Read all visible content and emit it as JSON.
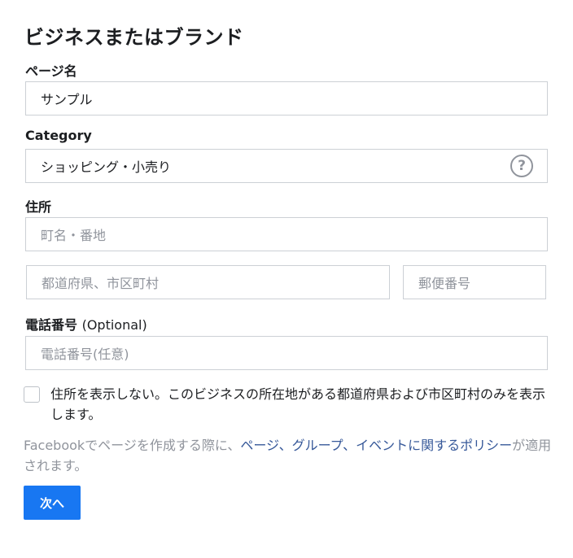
{
  "form": {
    "title": "ビジネスまたはブランド",
    "page_name": {
      "label": "ページ名",
      "value": "サンプル"
    },
    "category": {
      "label": "Category",
      "value": "ショッピング・小売り",
      "help_glyph": "?"
    },
    "address": {
      "label": "住所",
      "street_placeholder": "町名・番地",
      "city_placeholder": "都道府県、市区町村",
      "zip_placeholder": "郵便番号"
    },
    "phone": {
      "label": "電話番号",
      "label_suffix": "(Optional)",
      "placeholder": "電話番号(任意)"
    },
    "hide_address": {
      "checked": false,
      "text": "住所を表示しない。このビジネスの所在地がある都道府県および市区町村のみを表示します。"
    },
    "policy": {
      "prefix": "Facebookでページを作成する際に、",
      "link": "ページ、グループ、イベントに関するポリシー",
      "suffix": "が適用されます。"
    },
    "next_button": "次へ"
  },
  "colors": {
    "primary_button": "#1877f2",
    "link": "#365899",
    "muted_text": "#90949c",
    "border": "#ccd0d5"
  }
}
